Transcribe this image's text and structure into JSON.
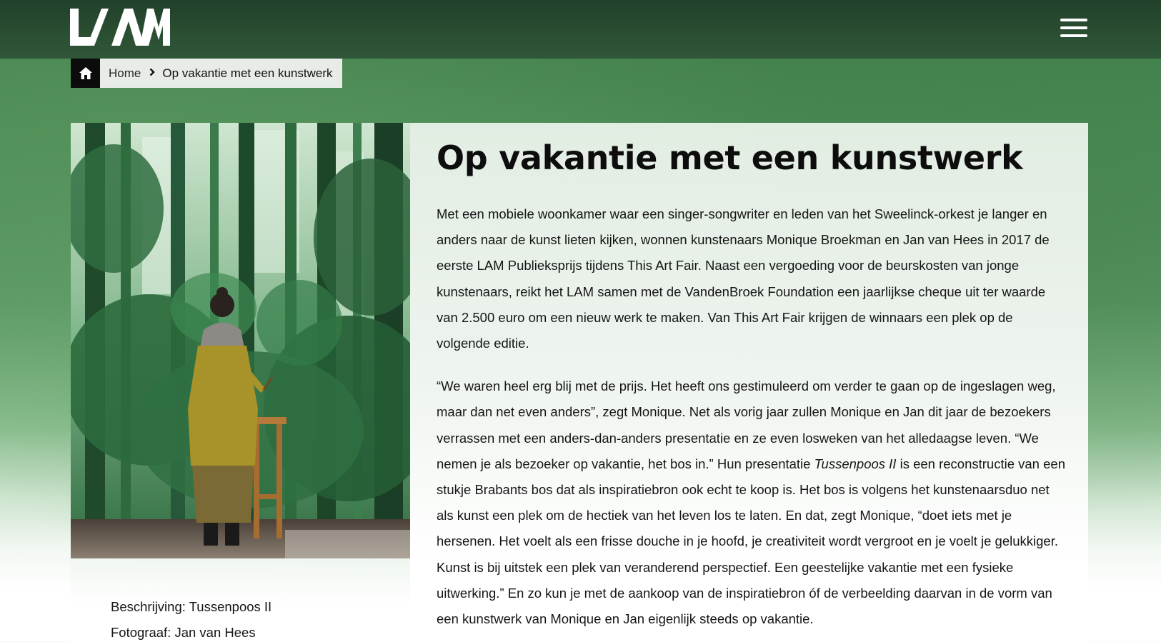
{
  "header": {
    "logo_text": "LAM",
    "menu_icon": "hamburger-menu-icon"
  },
  "breadcrumb": {
    "home_icon": "home-icon",
    "home_label": "Home",
    "separator_icon": "chevron-right-icon",
    "current": "Op vakantie met een kunstwerk"
  },
  "article": {
    "title": "Op vakantie met een kunstwerk",
    "p1": "Met een mobiele woonkamer waar een singer-songwriter en leden van het Sweelinck-orkest je langer en anders naar de kunst lieten kijken, wonnen kunstenaars Monique Broekman en Jan van Hees in 2017 de eerste LAM Publieksprijs tijdens This Art Fair. Naast een vergoeding voor de beurskosten van jonge kunstenaars, reikt het LAM samen met de VandenBroek Foundation een jaarlijkse cheque uit ter waarde van 2.500 euro om een nieuw werk te maken. Van This Art Fair krijgen de winnaars een plek op de volgende editie.",
    "p2_before": "“We waren heel erg blij met de prijs. Het heeft ons gestimuleerd om verder te gaan op de ingeslagen weg, maar dan net even anders”, zegt Monique. Net als vorig jaar zullen Monique en Jan dit jaar de bezoekers verrassen met een anders-dan-anders presentatie en ze even losweken van het alledaagse leven. “We nemen je als bezoeker op vakantie, het bos in.” Hun presentatie ",
    "p2_italic": "Tussenpoos II",
    "p2_after": " is een reconstructie van een stukje Brabants bos dat als inspiratiebron ook echt te koop is. Het bos is volgens het kunstenaarsduo net als kunst een plek om de hectiek van het leven los te laten. En dat, zegt Monique, “doet iets met je hersenen. Het voelt als een frisse douche in je hoofd, je creativiteit wordt vergroot en je voelt je gelukkiger. Kunst is bij uitstek een plek van veranderend perspectief. Een geestelijke vakantie met een fysieke uitwerking.” En zo kun je met de aankoop van de inspiratiebron óf de verbeelding daarvan in de vorm van een kunstwerk van Monique en Jan eigenlijk steeds op vakantie."
  },
  "image": {
    "description_line": "Beschrijving: Tussenpoos II",
    "photographer_line": "Fotograaf: Jan van Hees"
  },
  "colors": {
    "header_bg": "#21402a",
    "page_green": "#4d8d56",
    "text": "#151515"
  }
}
